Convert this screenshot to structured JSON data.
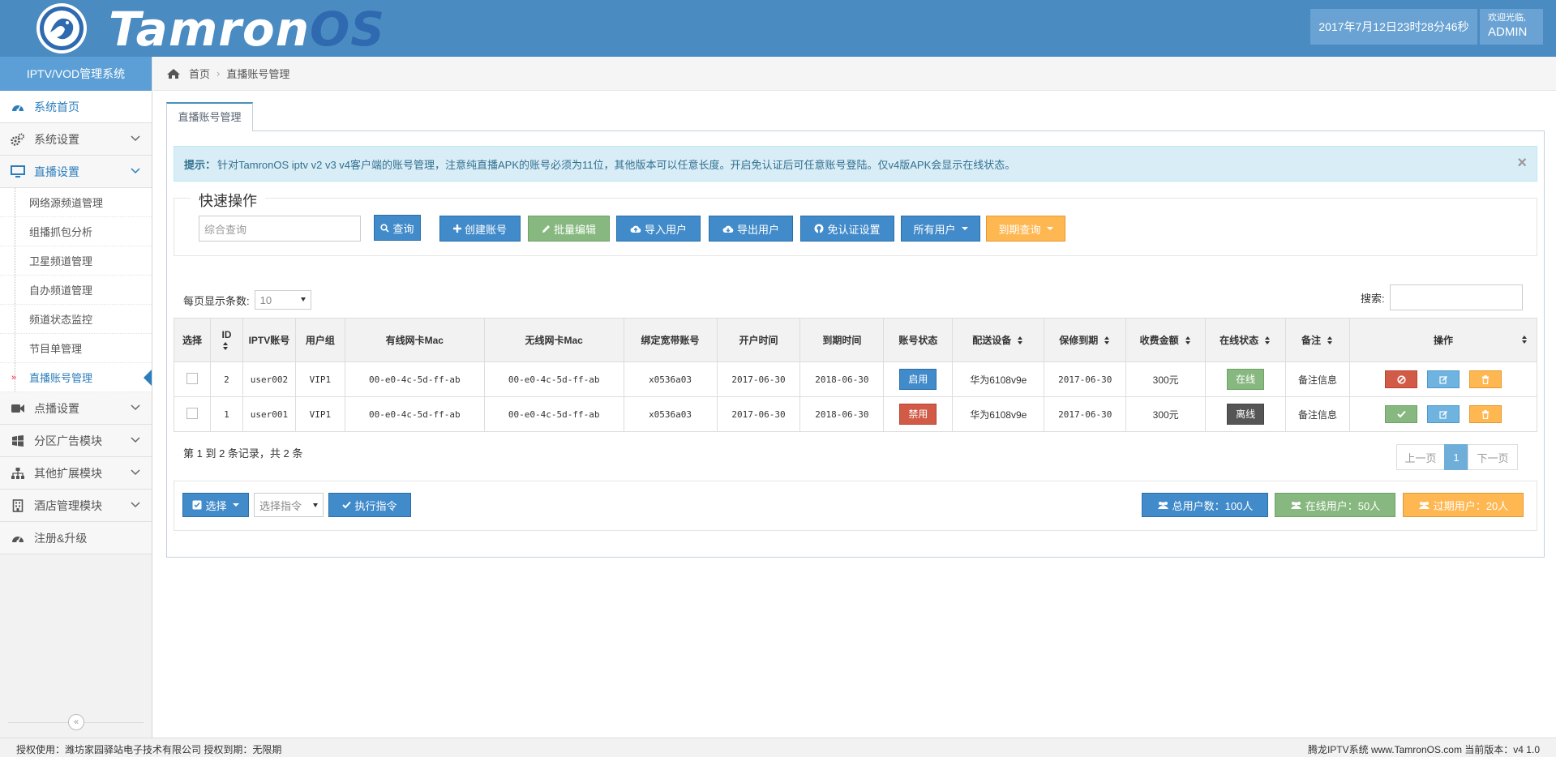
{
  "header": {
    "brand_part1": "Tamron",
    "brand_part2": "OS",
    "datetime": "2017年7月12日23时28分46秒",
    "welcome": "欢迎光临,",
    "username": "ADMIN"
  },
  "sidebar": {
    "title": "IPTV/VOD管理系统",
    "items": [
      {
        "label": "系统首页",
        "icon": "dashboard-icon"
      },
      {
        "label": "系统设置",
        "icon": "gears-icon"
      },
      {
        "label": "直播设置",
        "icon": "monitor-icon"
      },
      {
        "label": "点播设置",
        "icon": "video-camera-icon"
      },
      {
        "label": "分区广告模块",
        "icon": "windows-icon"
      },
      {
        "label": "其他扩展模块",
        "icon": "sitemap-icon"
      },
      {
        "label": "酒店管理模块",
        "icon": "building-icon"
      },
      {
        "label": "注册&升级",
        "icon": "dashboard-icon"
      }
    ],
    "sub_items": [
      "网络源频道管理",
      "组播抓包分析",
      "卫星频道管理",
      "自办频道管理",
      "频道状态监控",
      "节目单管理",
      "直播账号管理"
    ],
    "collapse_icon": "«"
  },
  "breadcrumb": {
    "home": "首页",
    "sep": "›",
    "current": "直播账号管理"
  },
  "tab": {
    "label": "直播账号管理"
  },
  "alert": {
    "prefix": "提示：",
    "text": "针对TamronOS iptv v2 v3 v4客户端的账号管理，注意纯直播APK的账号必须为11位，其他版本可以任意长度。开启免认证后可任意账号登陆。仅v4版APK会显示在线状态。",
    "close": "×"
  },
  "quick": {
    "legend": "快速操作",
    "search_placeholder": "综合查询",
    "query": "查询",
    "create": "创建账号",
    "batch": "批量编辑",
    "import": "导入用户",
    "export": "导出用户",
    "noauth": "免认证设置",
    "all_users": "所有用户",
    "expiry_query": "到期查询"
  },
  "list": {
    "perpage_label": "每页显示条数:",
    "perpage_value": "10",
    "search_label": "搜索:"
  },
  "table": {
    "headers": [
      "选择",
      "ID",
      "IPTV账号",
      "用户组",
      "有线网卡Mac",
      "无线网卡Mac",
      "绑定宽带账号",
      "开户时间",
      "到期时间",
      "账号状态",
      "配送设备",
      "保修到期",
      "收费金额",
      "在线状态",
      "备注",
      "操作"
    ],
    "rows": [
      {
        "id": "2",
        "account": "user002",
        "group": "VIP1",
        "wired_mac": "00-e0-4c-5d-ff-ab",
        "wifi_mac": "00-e0-4c-5d-ff-ab",
        "broadband": "x0536a03",
        "open": "2017-06-30",
        "expire": "2018-06-30",
        "status": "启用",
        "device": "华为6108v9e",
        "warranty": "2017-06-30",
        "fee": "300元",
        "online": "在线",
        "remark": "备注信息"
      },
      {
        "id": "1",
        "account": "user001",
        "group": "VIP1",
        "wired_mac": "00-e0-4c-5d-ff-ab",
        "wifi_mac": "00-e0-4c-5d-ff-ab",
        "broadband": "x0536a03",
        "open": "2017-06-30",
        "expire": "2018-06-30",
        "status": "禁用",
        "device": "华为6108v9e",
        "warranty": "2017-06-30",
        "fee": "300元",
        "online": "离线",
        "remark": "备注信息"
      }
    ]
  },
  "pagination": {
    "info": "第 1 到 2 条记录，共 2 条",
    "prev": "上一页",
    "page": "1",
    "next": "下一页"
  },
  "bottom": {
    "select": "选择",
    "command_placeholder": "选择指令",
    "execute": "执行指令",
    "total": "总用户数：100人",
    "online": "在线用户：50人",
    "expired": "过期用户：20人"
  },
  "footer": {
    "left": "授权使用：潍坊家园驿站电子技术有限公司 授权到期：无限期",
    "right": "腾龙IPTV系统 www.TamronOS.com 当前版本：v4 1.0"
  }
}
